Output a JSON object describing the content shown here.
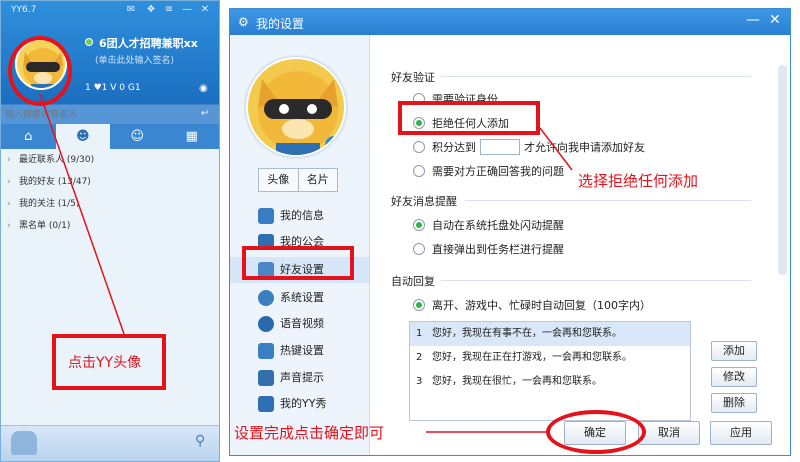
{
  "yy_panel": {
    "version": "YY6.7",
    "user_name": "6团人才招聘兼职xx",
    "signature": "(单击此处输入签名)",
    "stats": "1 ♥1 V 0 G1",
    "search_placeholder": "输入搜索内容进入",
    "groups": [
      {
        "label": "最近联系人 (9/30)"
      },
      {
        "label": "我的好友 (13/47)"
      },
      {
        "label": "我的关注 (1/5)"
      },
      {
        "label": "黑名单 (0/1)"
      }
    ]
  },
  "settings": {
    "title": "我的设置",
    "avatar_buttons": [
      "头像",
      "名片"
    ],
    "sidebar": [
      {
        "label": "我的信息",
        "color": "#3a7cc4"
      },
      {
        "label": "我的公会",
        "color": "#2d6fb0"
      },
      {
        "label": "好友设置",
        "color": "#4b86c7"
      },
      {
        "label": "系统设置",
        "color": "#3b7fc0"
      },
      {
        "label": "语音视频",
        "color": "#2a6aac"
      },
      {
        "label": "热键设置",
        "color": "#3a7ec4"
      },
      {
        "label": "声音提示",
        "color": "#336fae"
      },
      {
        "label": "我的YY秀",
        "color": "#2f6fb6"
      }
    ],
    "friend_verify": {
      "title": "好友验证",
      "options": [
        "需要验证身份",
        "拒绝任何人添加",
        "积分达到",
        "需要对方正确回答我的问题"
      ],
      "score_suffix": "才允许向我申请添加好友"
    },
    "friend_msg": {
      "title": "好友消息提醒",
      "options": [
        "自动在系统托盘处闪动提醒",
        "直接弹出到任务栏进行提醒"
      ]
    },
    "auto_reply": {
      "title": "自动回复",
      "option": "离开、游戏中、忙碌时自动回复（100字内）",
      "items": [
        {
          "num": "1",
          "text": "您好，我现在有事不在，一会再和您联系。"
        },
        {
          "num": "2",
          "text": "您好，我现在正在打游戏，一会再和您联系。"
        },
        {
          "num": "3",
          "text": "您好，我现在很忙，一会再和您联系。"
        }
      ],
      "buttons": [
        "添加",
        "修改",
        "删除"
      ]
    },
    "footer": {
      "ok": "确定",
      "cancel": "取消",
      "apply": "应用"
    }
  },
  "annotations": {
    "click_avatar": "点击YY头像",
    "choose_reject": "选择拒绝任何添加",
    "finish_ok": "设置完成点击确定即可",
    "color": "#e4131b"
  }
}
